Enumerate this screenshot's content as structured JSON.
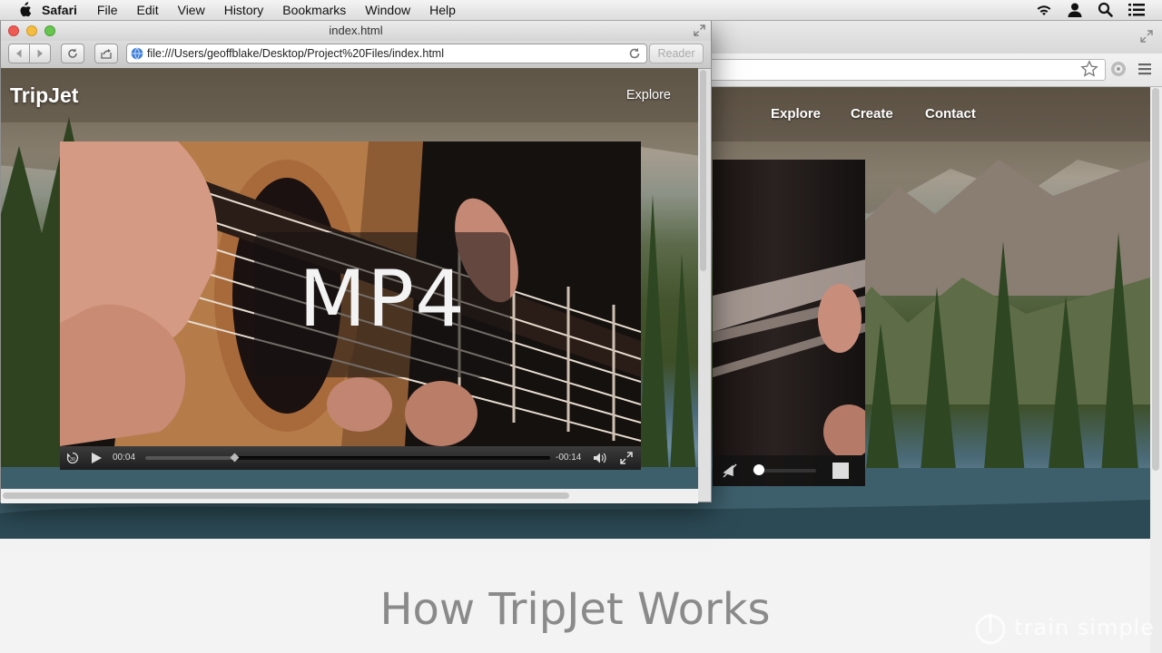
{
  "menubar": {
    "app": "Safari",
    "items": [
      "File",
      "Edit",
      "View",
      "History",
      "Bookmarks",
      "Window",
      "Help"
    ],
    "status_icons": [
      "wifi-icon",
      "user-icon",
      "spotlight-icon",
      "notification-center-icon"
    ]
  },
  "safari": {
    "title": "index.html",
    "url": "file:///Users/geoffblake/Desktop/Project%20Files/index.html",
    "reader_label": "Reader"
  },
  "site": {
    "brand": "TripJet",
    "nav_small": "Explore",
    "nav": [
      "Explore",
      "Create",
      "Contact"
    ],
    "heading": "How TripJet Works"
  },
  "video": {
    "overlay_text": "MP4",
    "current_time": "00:04",
    "remaining_time": "-00:14",
    "progress": 0.22
  },
  "background_video": {
    "volume": 0.1
  },
  "watermark": "train simple",
  "colors": {
    "mac_red": "#ee5b53",
    "mac_yellow": "#f5bd3f",
    "mac_green": "#66c64d",
    "heading_gray": "#8a8a8a"
  }
}
